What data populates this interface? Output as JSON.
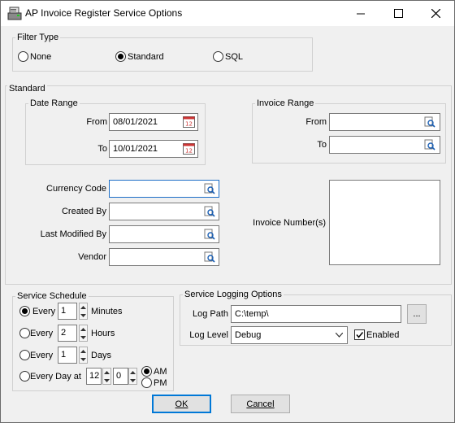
{
  "window": {
    "title": "AP Invoice Register Service Options"
  },
  "filter_type": {
    "label": "Filter Type",
    "options": [
      {
        "label": "None",
        "selected": false
      },
      {
        "label": "Standard",
        "selected": true
      },
      {
        "label": "SQL",
        "selected": false
      }
    ]
  },
  "standard": {
    "label": "Standard",
    "date_range": {
      "label": "Date Range",
      "from_label": "From",
      "from_value": "08/01/2021",
      "to_label": "To",
      "to_value": "10/01/2021"
    },
    "invoice_range": {
      "label": "Invoice Range",
      "from_label": "From",
      "from_value": "",
      "to_label": "To",
      "to_value": ""
    },
    "currency_code_label": "Currency Code",
    "currency_code_value": "",
    "created_by_label": "Created By",
    "created_by_value": "",
    "last_modified_by_label": "Last Modified By",
    "last_modified_by_value": "",
    "vendor_label": "Vendor",
    "vendor_value": "",
    "invoice_numbers_label": "Invoice Number(s)",
    "invoice_numbers_value": ""
  },
  "service_schedule": {
    "label": "Service Schedule",
    "every_label": "Every",
    "minutes_value": "1",
    "minutes_label": "Minutes",
    "hours_value": "2",
    "hours_label": "Hours",
    "days_value": "1",
    "days_label": "Days",
    "every_day_at_label": "Every Day at",
    "hour_value": "12",
    "minute_value": "0",
    "am_label": "AM",
    "pm_label": "PM",
    "selected": "minutes",
    "ampm_selected": "AM"
  },
  "logging": {
    "label": "Service Logging Options",
    "log_path_label": "Log Path",
    "log_path_value": "C:\\temp\\",
    "browse_label": "...",
    "log_level_label": "Log Level",
    "log_level_value": "Debug",
    "enabled_label": "Enabled",
    "enabled": true
  },
  "buttons": {
    "ok": "OK",
    "cancel": "Cancel"
  },
  "colors": {
    "accent": "#0078d7",
    "focus_border": "#1e6fc7",
    "dialog_bg": "#f0f0f0"
  }
}
